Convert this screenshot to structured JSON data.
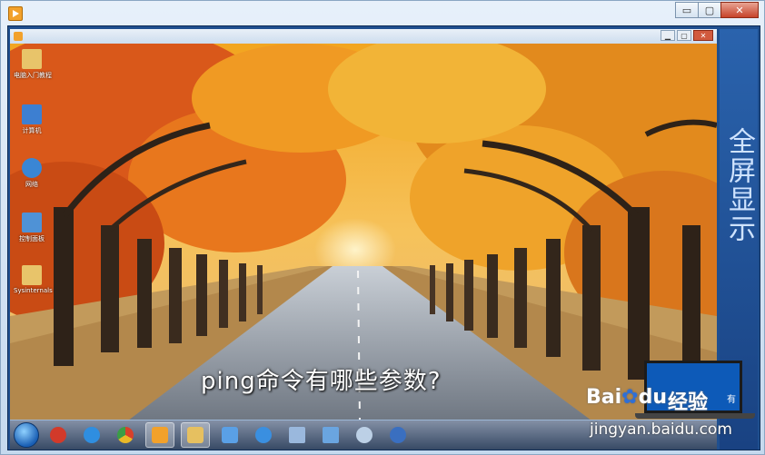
{
  "outer_window": {
    "controls": {
      "minimize": "▭",
      "maximize": "▢",
      "close": "✕"
    }
  },
  "inner_window": {
    "controls": {
      "minimize": "▁",
      "maximize": "▢",
      "close": "✕"
    }
  },
  "desktop_icons": [
    {
      "label": "电脑入门教程",
      "icon": "folder-icon",
      "color": "#e8c46a"
    },
    {
      "label": "计算机",
      "icon": "computer-icon",
      "color": "#3d7fd1"
    },
    {
      "label": "网络",
      "icon": "network-icon",
      "color": "#3a86d4"
    },
    {
      "label": "控制面板",
      "icon": "control-panel-icon",
      "color": "#4f92d6"
    },
    {
      "label": "Sysinternals",
      "icon": "folder-icon",
      "color": "#e8c46a"
    }
  ],
  "subtitle": "ping命令有哪些参数?",
  "taskbar_items": [
    {
      "icon": "start-orb-icon"
    },
    {
      "icon": "app-red-icon",
      "color": "#d23a2a"
    },
    {
      "icon": "ie-icon",
      "color": "#2f8ee0"
    },
    {
      "icon": "chrome-icon",
      "color": "#e9b928"
    },
    {
      "icon": "media-player-icon",
      "color": "#f2a12b",
      "active": true
    },
    {
      "icon": "explorer-icon",
      "color": "#e6c060",
      "active": true
    },
    {
      "icon": "windows-icon",
      "color": "#5aa0e6"
    },
    {
      "icon": "qq-icon",
      "color": "#3a8fe0"
    },
    {
      "icon": "document-icon",
      "color": "#9ab8dd"
    },
    {
      "icon": "network-tool-icon",
      "color": "#6aa5e0"
    },
    {
      "icon": "gear-icon",
      "color": "#bcd0e6"
    },
    {
      "icon": "app-blue-icon",
      "color": "#3a6fc0"
    }
  ],
  "side_panel": {
    "text": "全屏显示"
  },
  "watermark": {
    "logo": "Bai",
    "logo_paw": "du",
    "jingyan": "经验",
    "url": "jingyan.baidu.com",
    "laptop_text": "有"
  }
}
